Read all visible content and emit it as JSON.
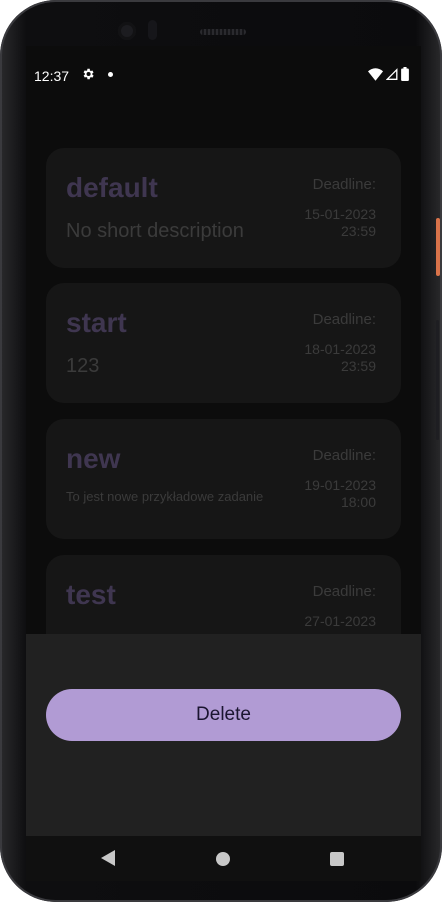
{
  "status_bar": {
    "time": "12:37",
    "icons": [
      "gear-icon",
      "notification-dot",
      "wifi-icon",
      "signal-icon",
      "battery-icon"
    ]
  },
  "tasks": [
    {
      "title": "default",
      "description": "No short description",
      "deadline_label": "Deadline:",
      "deadline_date": "15-01-2023",
      "deadline_time": "23:59"
    },
    {
      "title": "start",
      "description": "123",
      "deadline_label": "Deadline:",
      "deadline_date": "18-01-2023",
      "deadline_time": "23:59"
    },
    {
      "title": "new",
      "description": "To jest nowe przykładowe zadanie",
      "deadline_label": "Deadline:",
      "deadline_date": "19-01-2023",
      "deadline_time": "18:00"
    },
    {
      "title": "test",
      "description": "",
      "deadline_label": "Deadline:",
      "deadline_date": "27-01-2023",
      "deadline_time": ""
    }
  ],
  "sheet": {
    "delete_label": "Delete"
  },
  "colors": {
    "accent": "#b19bd4",
    "card_bg": "#161616",
    "title_dim": "#3f3650",
    "sheet_bg": "#212121"
  }
}
